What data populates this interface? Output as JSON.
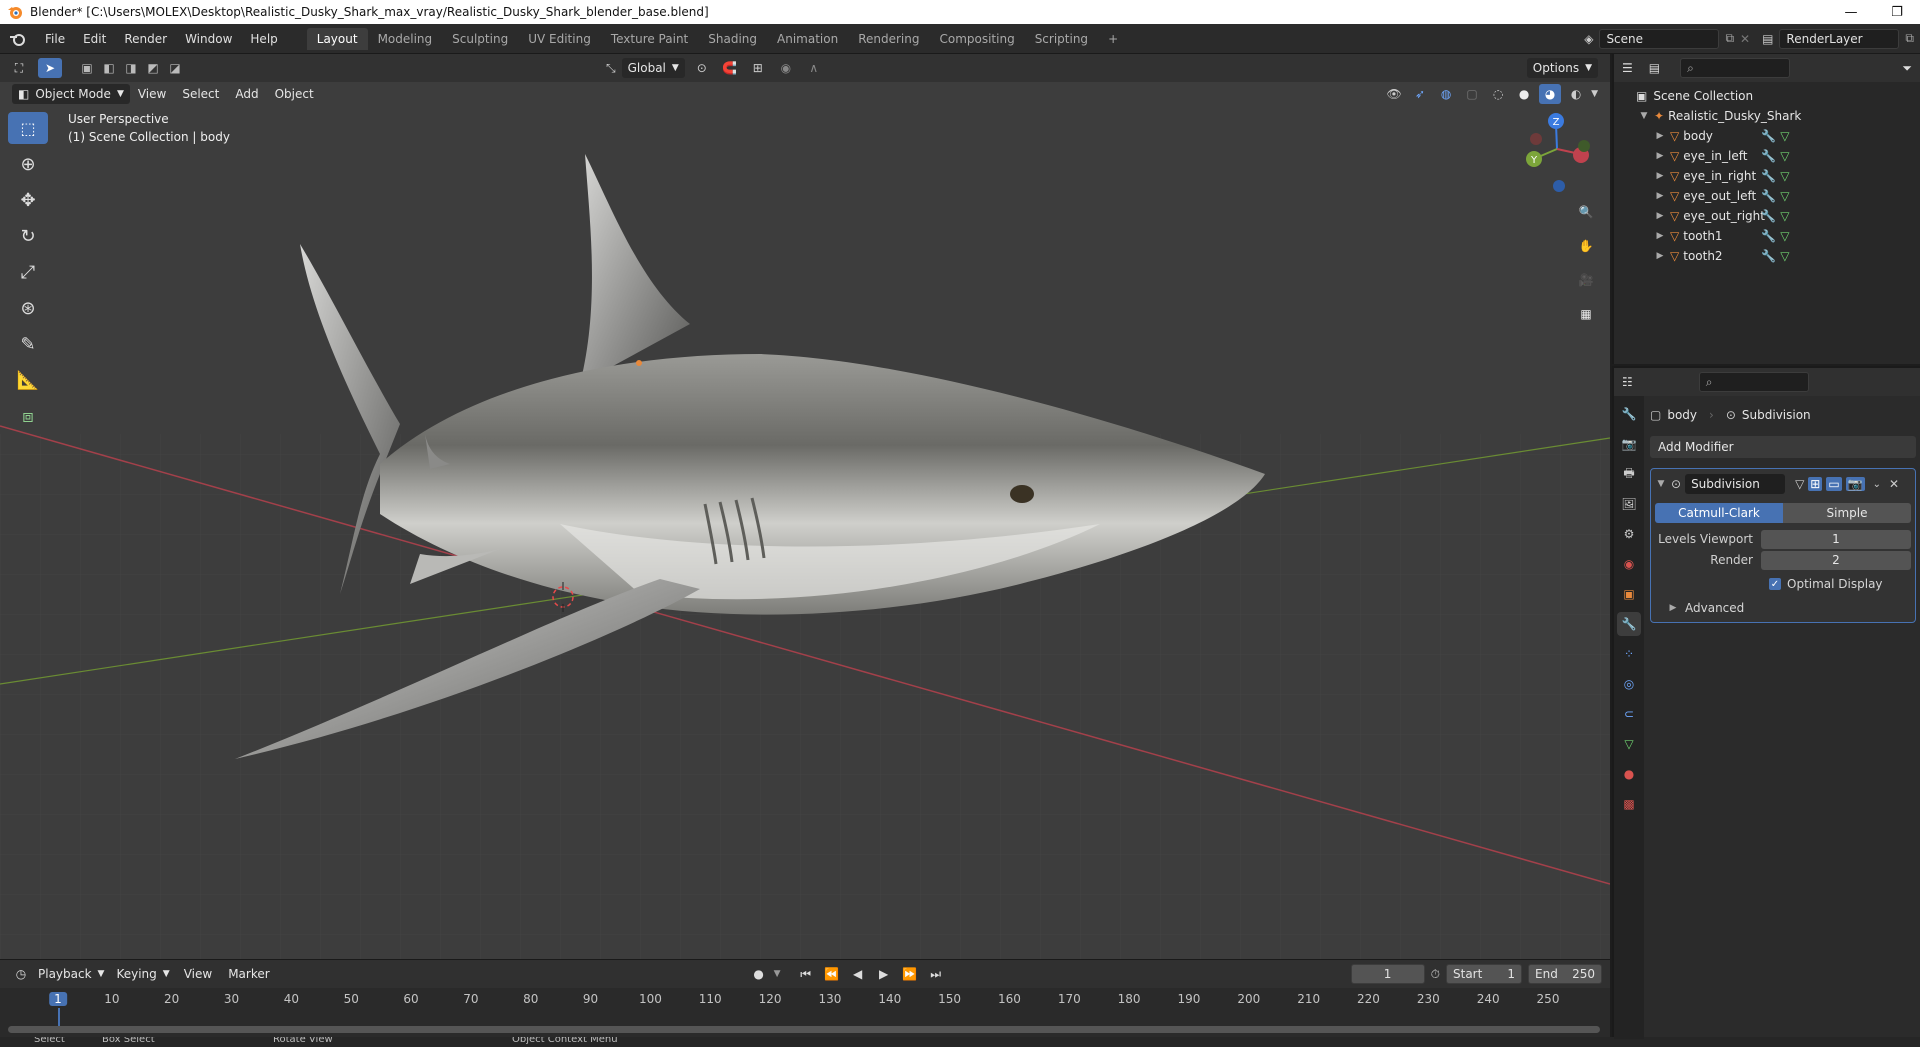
{
  "window": {
    "title": "Blender* [C:\\Users\\MOLEX\\Desktop\\Realistic_Dusky_Shark_max_vray/Realistic_Dusky_Shark_blender_base.blend]",
    "minimize": "—",
    "restore": "❐"
  },
  "menu": {
    "items": [
      "File",
      "Edit",
      "Render",
      "Window",
      "Help"
    ]
  },
  "workspaces": {
    "tabs": [
      "Layout",
      "Modeling",
      "Sculpting",
      "UV Editing",
      "Texture Paint",
      "Shading",
      "Animation",
      "Rendering",
      "Compositing",
      "Scripting"
    ],
    "active": "Layout",
    "add": "+"
  },
  "scene": {
    "name": "Scene",
    "render_layer": "RenderLayer"
  },
  "viewport": {
    "mode": "Object Mode",
    "menus": [
      "View",
      "Select",
      "Add",
      "Object"
    ],
    "transform_orientation": "Global",
    "options": "Options",
    "info_line1": "User Perspective",
    "info_line2": "(1) Scene Collection | body",
    "gizmo_z": "Z",
    "gizmo_y": "Y"
  },
  "timeline": {
    "menus": [
      "Playback",
      "Keying",
      "View",
      "Marker"
    ],
    "current_frame": "1",
    "start_label": "Start",
    "start": "1",
    "end_label": "End",
    "end": "250",
    "ruler": [
      "1",
      "10",
      "20",
      "30",
      "40",
      "50",
      "60",
      "70",
      "80",
      "90",
      "100",
      "110",
      "120",
      "130",
      "140",
      "150",
      "160",
      "170",
      "180",
      "190",
      "200",
      "210",
      "220",
      "230",
      "240",
      "250"
    ]
  },
  "statusbar": {
    "items": [
      "Select",
      "Box Select",
      "Rotate View",
      "Object Context Menu"
    ]
  },
  "outliner": {
    "root": "Scene Collection",
    "collection": "Realistic_Dusky_Shark",
    "objects": [
      "body",
      "eye_in_left",
      "eye_in_right",
      "eye_out_left",
      "eye_out_right",
      "tooth1",
      "tooth2"
    ]
  },
  "properties": {
    "object": "body",
    "modifier_crumb": "Subdivision",
    "add_modifier": "Add Modifier",
    "modifier_name": "Subdivision",
    "method_catmull": "Catmull-Clark",
    "method_simple": "Simple",
    "levels_viewport_label": "Levels Viewport",
    "levels_viewport": "1",
    "render_label": "Render",
    "render": "2",
    "optimal_display": "Optimal Display",
    "advanced": "Advanced"
  },
  "colors": {
    "accent": "#4772b3",
    "x_axis": "#c0424e",
    "y_axis": "#7ca53a",
    "z_axis": "#3b7be0",
    "object_orange": "#e8893c"
  }
}
